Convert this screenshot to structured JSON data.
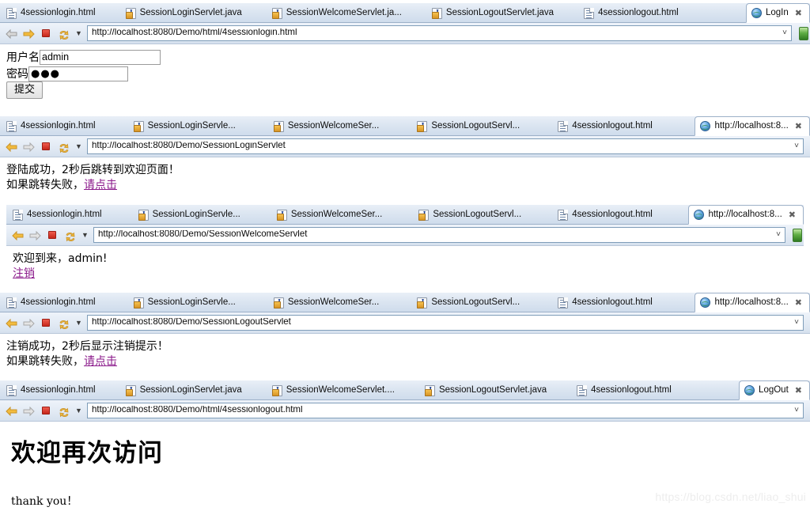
{
  "colors": {
    "tabstrip_bg": "#dbe5f1",
    "tab_border": "#9cb0c8",
    "link": "#8b1a8b",
    "stop_red": "#c6261a",
    "forward_orange": "#f3bc3e",
    "go_green": "#2f7a22",
    "watermark": "#ededed"
  },
  "watermark": "https://blog.csdn.net/liao_shui",
  "nav": {
    "back_icon": "back-arrow-icon",
    "forward_icon": "forward-arrow-icon",
    "stop_icon": "stop-icon",
    "refresh_icon": "refresh-icon",
    "dropdown_icon": "chevron-down-icon",
    "address_dropdown_icon": "chevron-down-icon",
    "go_icon": "go-icon"
  },
  "panels": [
    {
      "name": "login-form",
      "tabs": [
        {
          "label": "4sessionlogin.html",
          "icon": "html-file-icon",
          "active": false
        },
        {
          "label": "SessionLoginServlet.java",
          "icon": "java-file-icon",
          "active": false
        },
        {
          "label": "SessionWelcomeServlet.ja...",
          "icon": "java-file-icon",
          "active": false
        },
        {
          "label": "SessionLogoutServlet.java",
          "icon": "java-file-icon",
          "active": false
        },
        {
          "label": "4sessionlogout.html",
          "icon": "html-file-icon",
          "active": false
        },
        {
          "label": "LogIn",
          "icon": "globe-icon",
          "active": true,
          "closable": true
        }
      ],
      "url": "http://localhost:8080/Demo/html/4sessionlogin.html",
      "content": {
        "kind": "form",
        "username_label": "用户名",
        "username_value": "admin",
        "password_label": "密码",
        "password_value": "●●●",
        "submit_label": "提交"
      }
    },
    {
      "name": "login-servlet-result",
      "tabs": [
        {
          "label": "4sessionlogin.html",
          "icon": "html-file-icon",
          "active": false
        },
        {
          "label": "SessionLoginServle...",
          "icon": "java-file-icon",
          "active": false
        },
        {
          "label": "SessionWelcomeSer...",
          "icon": "java-file-icon",
          "active": false
        },
        {
          "label": "SessionLogoutServl...",
          "icon": "java-file-icon",
          "active": false
        },
        {
          "label": "4sessionlogout.html",
          "icon": "html-file-icon",
          "active": false
        },
        {
          "label": "http://localhost:8...",
          "icon": "globe-icon",
          "active": true,
          "closable": true
        }
      ],
      "url": "http://localhost:8080/Demo/SessionLoginServlet",
      "content": {
        "kind": "message",
        "line1": "登陆成功，2秒后跳转到欢迎页面！",
        "line2_prefix": "如果跳转失败，",
        "line2_link": "请点击"
      }
    },
    {
      "name": "welcome-servlet-result",
      "tabs": [
        {
          "label": "4sessionlogin.html",
          "icon": "html-file-icon",
          "active": false
        },
        {
          "label": "SessionLoginServle...",
          "icon": "java-file-icon",
          "active": false
        },
        {
          "label": "SessionWelcomeSer...",
          "icon": "java-file-icon",
          "active": false
        },
        {
          "label": "SessionLogoutServl...",
          "icon": "java-file-icon",
          "active": false
        },
        {
          "label": "4sessionlogout.html",
          "icon": "html-file-icon",
          "active": false
        },
        {
          "label": "http://localhost:8...",
          "icon": "globe-icon",
          "active": true,
          "closable": true
        }
      ],
      "url": "http://localhost:8080/Demo/SessionWelcomeServlet",
      "content": {
        "kind": "message",
        "line1": "欢迎到来，admin!",
        "line2_prefix": "",
        "line2_link": "注销"
      }
    },
    {
      "name": "logout-servlet-result",
      "tabs": [
        {
          "label": "4sessionlogin.html",
          "icon": "html-file-icon",
          "active": false
        },
        {
          "label": "SessionLoginServle...",
          "icon": "java-file-icon",
          "active": false
        },
        {
          "label": "SessionWelcomeSer...",
          "icon": "java-file-icon",
          "active": false
        },
        {
          "label": "SessionLogoutServl...",
          "icon": "java-file-icon",
          "active": false
        },
        {
          "label": "4sessionlogout.html",
          "icon": "html-file-icon",
          "active": false
        },
        {
          "label": "http://localhost:8...",
          "icon": "globe-icon",
          "active": true,
          "closable": true
        }
      ],
      "url": "http://localhost:8080/Demo/SessionLogoutServlet",
      "content": {
        "kind": "message",
        "line1": "注销成功，2秒后显示注销提示！",
        "line2_prefix": "如果跳转失败，",
        "line2_link": "请点击"
      }
    },
    {
      "name": "logout-page",
      "tabs": [
        {
          "label": "4sessionlogin.html",
          "icon": "html-file-icon",
          "active": false
        },
        {
          "label": "SessionLoginServlet.java",
          "icon": "java-file-icon",
          "active": false
        },
        {
          "label": "SessionWelcomeServlet....",
          "icon": "java-file-icon",
          "active": false
        },
        {
          "label": "SessionLogoutServlet.java",
          "icon": "java-file-icon",
          "active": false
        },
        {
          "label": "4sessionlogout.html",
          "icon": "html-file-icon",
          "active": false
        },
        {
          "label": "LogOut",
          "icon": "globe-icon",
          "active": true,
          "closable": true
        }
      ],
      "url": "http://localhost:8080/Demo/html/4sessionlogout.html",
      "content": {
        "kind": "logout",
        "heading": "欢迎再次访问",
        "thanks": "thank you！"
      }
    }
  ]
}
